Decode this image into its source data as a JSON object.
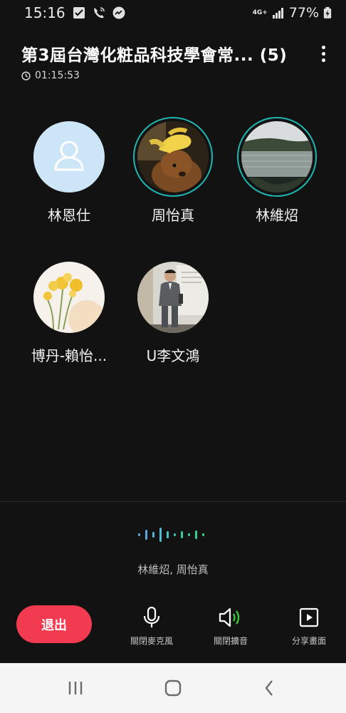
{
  "status_bar": {
    "time": "15:16",
    "icons": [
      "check-notification-icon",
      "wifi-call-icon",
      "messenger-icon"
    ],
    "network": "4G+",
    "battery": "77%"
  },
  "header": {
    "title": "第3屆台灣化粧品科技學會常... (5)",
    "duration": "01:15:53"
  },
  "participants": [
    {
      "name": "林恩仕",
      "avatar": "default-person-icon",
      "speaking": false
    },
    {
      "name": "周怡真",
      "avatar": "dog-with-banana-hat-photo",
      "speaking": true
    },
    {
      "name": "林維炤",
      "avatar": "lake-landscape-photo",
      "speaking": true
    },
    {
      "name": "博丹-賴怡...",
      "avatar": "yellow-flower-illustration",
      "speaking": false
    },
    {
      "name": "U李文鴻",
      "avatar": "man-in-suit-photo",
      "speaking": false
    }
  ],
  "speaking_now": "林維炤, 周怡真",
  "controls": {
    "exit_label": "退出",
    "mic_label": "關閉麥克風",
    "speaker_label": "關閉擴音",
    "share_label": "分享畫面"
  },
  "colors": {
    "accent_teal": "#1fb5b0",
    "exit_red": "#f23b50",
    "speaker_green": "#3fc83f"
  },
  "nav": [
    "recent-apps-icon",
    "home-icon",
    "back-icon"
  ]
}
